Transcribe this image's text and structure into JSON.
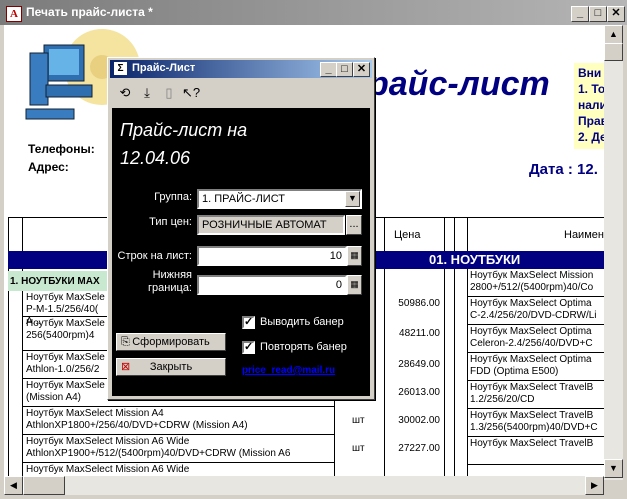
{
  "window": {
    "title": "Печать прайс-листа  *",
    "app_icon": "А",
    "buttons": {
      "minimize": "_",
      "maximize": "□",
      "close": "✕"
    }
  },
  "document": {
    "title": "райс-лист",
    "info_lines": [
      "Вни",
      "1. То",
      "нали",
      "Прав",
      "2. Де"
    ],
    "phones_label": "Телефоны:",
    "address_label": "Адрес:",
    "date_label": "Дата :  12.",
    "column_headers": {
      "price": "Цена",
      "name": "Наимено"
    },
    "section_title": "01. НОУТБУКИ",
    "group_row_label": "1. НОУТБУКИ МАХ",
    "left_rows": [
      {
        "lines": [
          "Ноутбук MaxSele",
          "P-M-1.5/256/40(",
          "A..."
        ],
        "price": "50986.00"
      },
      {
        "lines": [
          "Ноутбук MaxSele",
          "256(5400rpm)4"
        ],
        "price": "48211.00"
      },
      {
        "lines": [
          "Ноутбук MaxSele",
          "Athlon-1.0/256/2"
        ],
        "price": "28649.00"
      },
      {
        "lines": [
          "Ноутбук MaxSele",
          "(Mission A4)"
        ],
        "price": "26013.00"
      },
      {
        "lines": [
          "Ноутбук MaxSelect Mission A4",
          "AthlonXP1800+/256/40/DVD+CDRW (Mission A4)"
        ],
        "unit": "шт",
        "price": "30002.00"
      },
      {
        "lines": [
          "Ноутбук MaxSelect Mission A6 Wide",
          "AthlonXP1900+/512/(5400rpm)40/DVD+CDRW (Mission A6"
        ],
        "unit": "шт",
        "price": "27227.00"
      },
      {
        "lines": [
          "Ноутбук MaxSelect Mission A6 Wide"
        ],
        "unit": "",
        "price": ""
      }
    ],
    "right_rows": [
      [
        "Ноутбук MaxSelect Mission",
        "2800+/512/(5400rpm)40/Co"
      ],
      [
        "Ноутбук MaxSelect Optima",
        "C-2.4/256/20/DVD-CDRW/Li"
      ],
      [
        "Ноутбук MaxSelect Optima",
        "Celeron-2.4/256/40/DVD+C"
      ],
      [
        "Ноутбук MaxSelect Optima",
        "FDD (Optima E500)"
      ],
      [
        "Ноутбук MaxSelect TravelB",
        "1.2/256/20/CD"
      ],
      [
        "Ноутбук MaxSelect TravelB",
        "1.3/256(5400rpm)40/DVD+C"
      ],
      [
        "Ноутбук MaxSelect TravelB",
        ""
      ]
    ]
  },
  "dialog": {
    "title": "Прайс-Лист",
    "window_buttons": {
      "minimize": "_",
      "maximize": "□",
      "close": "✕"
    },
    "header_line1": "Прайс-лист   на",
    "header_line2": "12.04.06",
    "fields": {
      "group_label": "Группа:",
      "group_value": "1. ПРАЙС-ЛИСТ",
      "price_type_label": "Тип цен:",
      "price_type_value": "РОЗНИЧНЫЕ АВТОМАТ",
      "rows_per_sheet_label": "Строк на лист:",
      "rows_per_sheet_value": "10",
      "lower_bound_label_1": "Нижняя",
      "lower_bound_label_2": "граница:",
      "lower_bound_value": "0"
    },
    "buttons": {
      "generate": "Сформировать",
      "close": "Закрыть",
      "ellipsis": "..."
    },
    "checkboxes": {
      "show_banner": {
        "label": "Выводить банер",
        "checked": true
      },
      "repeat_banner": {
        "label": "Повторять банер",
        "checked": true
      }
    },
    "email": "price_read@mail.ru"
  }
}
